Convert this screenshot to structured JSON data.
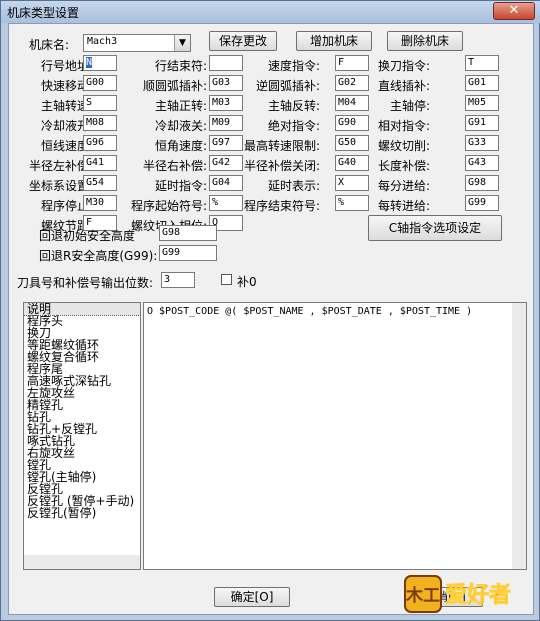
{
  "window": {
    "title": "机床类型设置",
    "close": "✕"
  },
  "machine_name_label": "机床名:",
  "machine_name_value": "Mach3",
  "buttons": {
    "save": "保存更改",
    "add": "增加机床",
    "delete": "删除机床",
    "c_axis": "C轴指令选项设定",
    "ok": "确定[O]",
    "cancel": "取消[C]"
  },
  "rows": [
    [
      "行号地址:",
      "N",
      "行结束符:",
      "",
      "速度指令:",
      "F",
      "换刀指令:",
      "T"
    ],
    [
      "快速移动:",
      "G00",
      "顺圆弧插补:",
      "G03",
      "逆圆弧插补:",
      "G02",
      "直线插补:",
      "G01"
    ],
    [
      "主轴转速:",
      "S",
      "主轴正转:",
      "M03",
      "主轴反转:",
      "M04",
      "主轴停:",
      "M05"
    ],
    [
      "冷却液开:",
      "M08",
      "冷却液关:",
      "M09",
      "绝对指令:",
      "G90",
      "相对指令:",
      "G91"
    ],
    [
      "恒线速度:",
      "G96",
      "恒角速度:",
      "G97",
      "最高转速限制:",
      "G50",
      "螺纹切削:",
      "G33"
    ],
    [
      "半径左补偿:",
      "G41",
      "半径右补偿:",
      "G42",
      "半径补偿关闭:",
      "G40",
      "长度补偿:",
      "G43"
    ],
    [
      "坐标系设置:",
      "G54",
      "延时指令:",
      "G04",
      "延时表示:",
      "X",
      "每分进给:",
      "G98"
    ],
    [
      "程序停止:",
      "M30",
      "程序起始符号:",
      "%",
      "程序结束符号:",
      "%",
      "每转进给:",
      "G99"
    ],
    [
      "螺纹节距:",
      "F",
      "螺纹切入相位:",
      "Q",
      "",
      "",
      "",
      ""
    ]
  ],
  "return_init_label": "回退初始安全高度",
  "return_init_value": "G98",
  "return_r_label": "回退R安全高度(G99):",
  "return_r_value": "G99",
  "tool_digits_label": "刀具号和补偿号输出位数:",
  "tool_digits_value": "3",
  "pad_zero_label": "补0",
  "list_items": [
    "说明",
    "程序头",
    "换刀",
    "等距螺纹循环",
    "螺纹复合循环",
    "程序尾",
    "高速啄式深钻孔",
    "左旋攻丝",
    "精镗孔",
    "钻孔",
    "钻孔+反镗孔",
    "啄式钻孔",
    "右旋攻丝",
    "镗孔",
    "镗孔(主轴停)",
    "反镗孔",
    "反镗孔 (暂停+手动)",
    "反镗孔(暂停)"
  ],
  "editor_text": "O $POST_CODE @( $POST_NAME , $POST_DATE , $POST_TIME )",
  "logo_text": "爱好者",
  "logo_glyph": "木工"
}
